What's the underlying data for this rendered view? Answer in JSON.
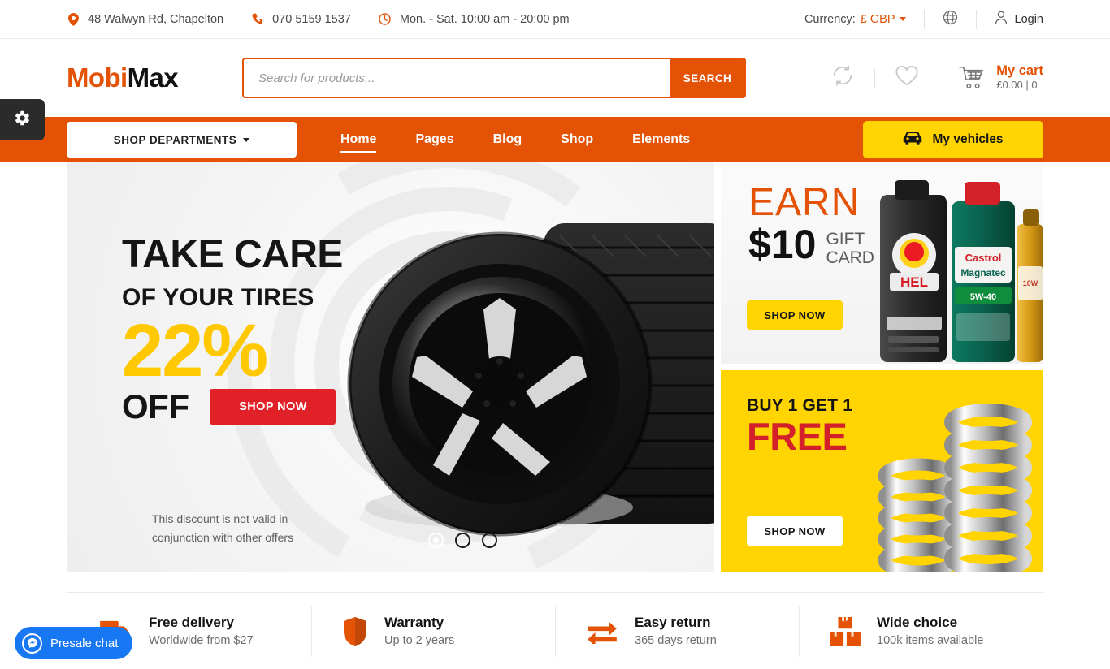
{
  "topbar": {
    "address": "48 Walwyn Rd, Chapelton",
    "phone": "070 5159 1537",
    "hours": "Mon. - Sat. 10:00 am - 20:00 pm",
    "currency_label": "Currency:",
    "currency_value": "£ GBP",
    "login": "Login"
  },
  "header": {
    "logo_first": "Mobi",
    "logo_second": "Max",
    "search_placeholder": "Search for products...",
    "search_value": "",
    "search_button": "SEARCH",
    "cart_title": "My cart",
    "cart_meta": "£0.00 | 0"
  },
  "nav": {
    "departments": "SHOP DEPARTMENTS",
    "links": [
      {
        "label": "Home",
        "active": true
      },
      {
        "label": "Pages",
        "active": false
      },
      {
        "label": "Blog",
        "active": false
      },
      {
        "label": "Shop",
        "active": false
      },
      {
        "label": "Elements",
        "active": false
      }
    ],
    "vehicles": "My vehicles"
  },
  "hero": {
    "line1": "TAKE CARE",
    "line2": "OF YOUR TIRES",
    "discount": "22%",
    "off": "OFF",
    "cta": "SHOP NOW",
    "disclaimer": "This discount is not valid in conjunction with other offers",
    "slides": [
      {
        "active": true
      },
      {
        "active": false
      },
      {
        "active": false
      }
    ]
  },
  "banners": {
    "earn": {
      "heading": "EARN",
      "amount": "$10",
      "gift_line1": "GIFT",
      "gift_line2": "CARD",
      "cta": "SHOP NOW"
    },
    "free": {
      "heading": "BUY 1 GET 1",
      "subheading": "FREE",
      "cta": "SHOP NOW"
    }
  },
  "features": [
    {
      "icon": "truck-icon",
      "title": "Free delivery",
      "subtitle": "Worldwide from $27"
    },
    {
      "icon": "shield-icon",
      "title": "Warranty",
      "subtitle": "Up to 2 years"
    },
    {
      "icon": "exchange-icon",
      "title": "Easy return",
      "subtitle": "365 days return"
    },
    {
      "icon": "boxes-icon",
      "title": "Wide choice",
      "subtitle": "100k items available"
    }
  ],
  "chat": {
    "label": "Presale chat"
  },
  "colors": {
    "brand_orange": "#E35205",
    "accent_yellow": "#FFD400",
    "hero_yellow": "#FFC800",
    "red": "#E12128",
    "chat_blue": "#1877F2"
  }
}
